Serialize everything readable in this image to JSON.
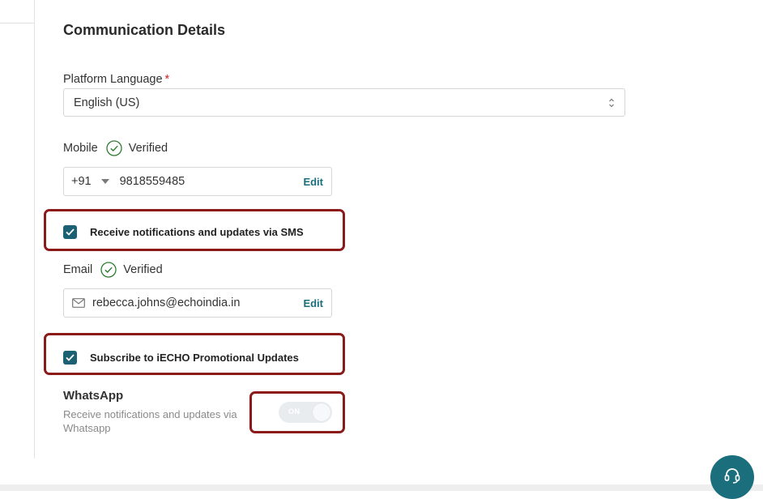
{
  "section": {
    "title": "Communication Details"
  },
  "language": {
    "label": "Platform Language",
    "required_mark": "*",
    "value": "English (US)"
  },
  "mobile": {
    "label": "Mobile",
    "status": "Verified",
    "country_code": "+91",
    "number": "9818559485",
    "edit_label": "Edit"
  },
  "sms_opt": {
    "label": "Receive notifications and updates via SMS",
    "checked": true
  },
  "email": {
    "label": "Email",
    "status": "Verified",
    "value": "rebecca.johns@echoindia.in",
    "edit_label": "Edit"
  },
  "promo_opt": {
    "label": "Subscribe to iECHO Promotional Updates",
    "checked": true
  },
  "whatsapp": {
    "title": "WhatsApp",
    "description": "Receive notifications and updates via Whatsapp",
    "toggle_label": "ON"
  },
  "colors": {
    "accent": "#1b6f7c",
    "checkbox": "#1b6173",
    "verified": "#2e7d32",
    "highlight": "#8b1a1a",
    "required": "#d21f1f"
  },
  "icons": {
    "verified": "check-circle-icon",
    "email": "envelope-icon",
    "select": "up-down-chevron-icon",
    "country": "caret-down-icon",
    "help": "headset-icon"
  }
}
